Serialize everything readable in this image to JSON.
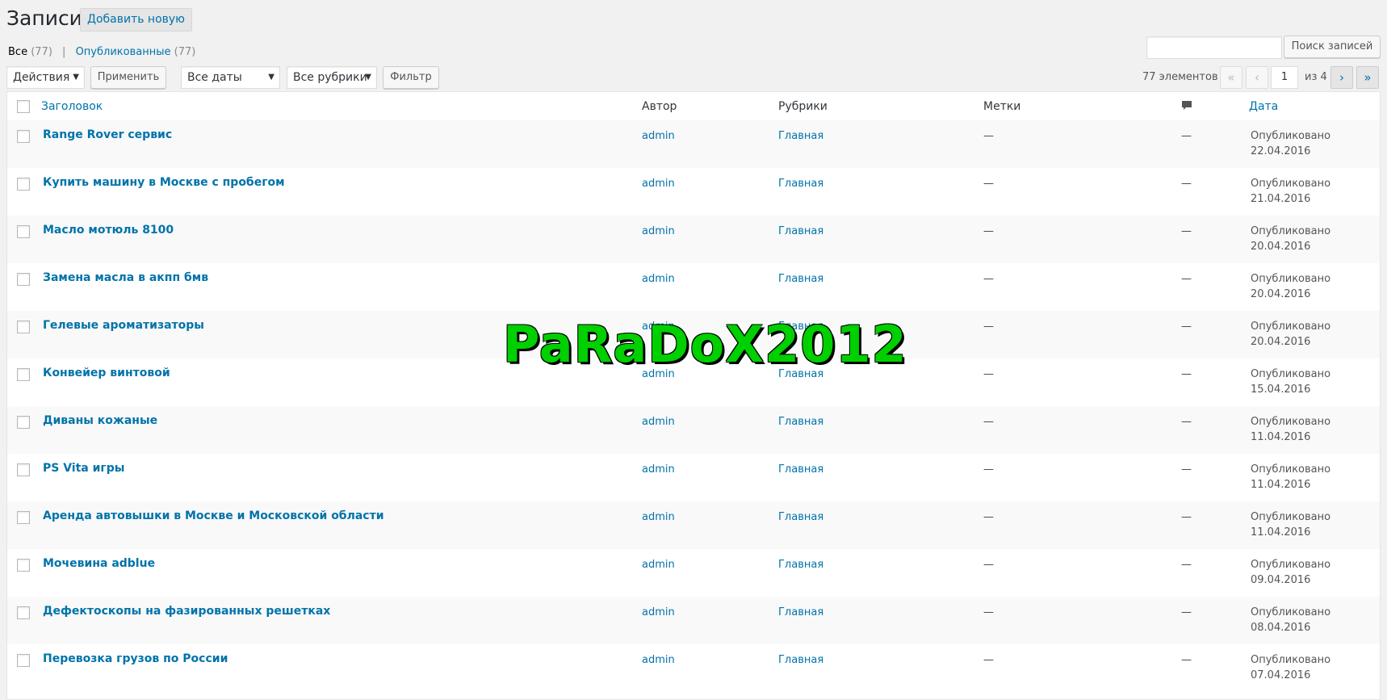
{
  "header": {
    "title": "Записи",
    "add_new": "Добавить новую"
  },
  "views": {
    "all_label": "Все",
    "all_count": "(77)",
    "separator": "|",
    "published_label": "Опубликованные",
    "published_count": "(77)"
  },
  "search": {
    "button": "Поиск записей",
    "value": ""
  },
  "filters": {
    "bulk_action": "Действия",
    "apply": "Применить",
    "dates": "Все даты",
    "categories": "Все рубрики",
    "filter": "Фильтр"
  },
  "pagination": {
    "total": "77 элементов",
    "first": "«",
    "prev": "‹",
    "current_page": "1",
    "of_text": "из 4",
    "next": "›",
    "last": "»"
  },
  "columns": {
    "title": "Заголовок",
    "author": "Автор",
    "categories": "Рубрики",
    "tags": "Метки",
    "comments_icon": "comment-icon",
    "date": "Дата"
  },
  "rows": [
    {
      "title": "Range Rover сервис",
      "author": "admin",
      "category": "Главная",
      "tags": "—",
      "comments": "—",
      "status": "Опубликовано",
      "date": "22.04.2016"
    },
    {
      "title": "Купить машину в Москве с пробегом",
      "author": "admin",
      "category": "Главная",
      "tags": "—",
      "comments": "—",
      "status": "Опубликовано",
      "date": "21.04.2016"
    },
    {
      "title": "Масло мотюль 8100",
      "author": "admin",
      "category": "Главная",
      "tags": "—",
      "comments": "—",
      "status": "Опубликовано",
      "date": "20.04.2016"
    },
    {
      "title": "Замена масла в акпп бмв",
      "author": "admin",
      "category": "Главная",
      "tags": "—",
      "comments": "—",
      "status": "Опубликовано",
      "date": "20.04.2016"
    },
    {
      "title": "Гелевые ароматизаторы",
      "author": "admin",
      "category": "Главная",
      "tags": "—",
      "comments": "—",
      "status": "Опубликовано",
      "date": "20.04.2016"
    },
    {
      "title": "Конвейер винтовой",
      "author": "admin",
      "category": "Главная",
      "tags": "—",
      "comments": "—",
      "status": "Опубликовано",
      "date": "15.04.2016"
    },
    {
      "title": "Диваны кожаные",
      "author": "admin",
      "category": "Главная",
      "tags": "—",
      "comments": "—",
      "status": "Опубликовано",
      "date": "11.04.2016"
    },
    {
      "title": "PS Vita игры",
      "author": "admin",
      "category": "Главная",
      "tags": "—",
      "comments": "—",
      "status": "Опубликовано",
      "date": "11.04.2016"
    },
    {
      "title": "Аренда автовышки в Москве и Московской области",
      "author": "admin",
      "category": "Главная",
      "tags": "—",
      "comments": "—",
      "status": "Опубликовано",
      "date": "11.04.2016"
    },
    {
      "title": "Мочевина adblue",
      "author": "admin",
      "category": "Главная",
      "tags": "—",
      "comments": "—",
      "status": "Опубликовано",
      "date": "09.04.2016"
    },
    {
      "title": "Дефектоскопы на фазированных решетках",
      "author": "admin",
      "category": "Главная",
      "tags": "—",
      "comments": "—",
      "status": "Опубликовано",
      "date": "08.04.2016"
    },
    {
      "title": "Перевозка грузов по России",
      "author": "admin",
      "category": "Главная",
      "tags": "—",
      "comments": "—",
      "status": "Опубликовано",
      "date": "07.04.2016"
    }
  ],
  "watermark": "PaRaDoX2012",
  "colors": {
    "link": "#0073aa",
    "watermark": "#00d000",
    "background": "#f1f1f1"
  }
}
